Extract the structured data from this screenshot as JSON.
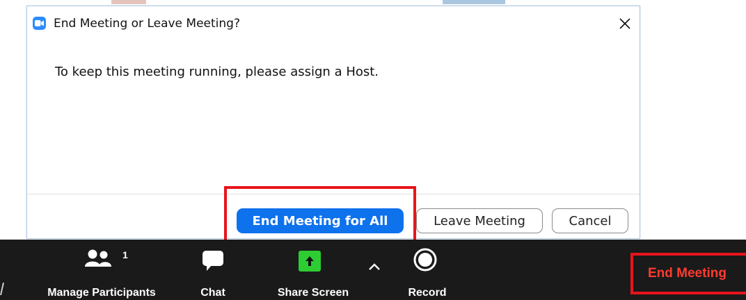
{
  "dialog": {
    "title": "End Meeting or Leave Meeting?",
    "message": "To keep this meeting running, please assign a Host.",
    "buttons": {
      "end_for_all": "End Meeting for All",
      "leave": "Leave Meeting",
      "cancel": "Cancel"
    },
    "icons": {
      "app": "zoom-camera-icon",
      "close": "close-icon"
    }
  },
  "toolbar": {
    "manage_participants": {
      "label": "Manage Participants",
      "count": "1",
      "icon": "participants-icon"
    },
    "chat": {
      "label": "Chat",
      "icon": "chat-icon"
    },
    "share_screen": {
      "label": "Share Screen",
      "icon": "share-screen-icon"
    },
    "record": {
      "label": "Record",
      "icon": "record-icon"
    },
    "end_meeting": {
      "label": "End Meeting"
    }
  },
  "colors": {
    "primary_blue": "#0e72ed",
    "highlight_red": "#e8141c",
    "end_meeting_red": "#ff3b30",
    "share_green": "#2dcc33",
    "toolbar_bg": "#1a1a1a"
  }
}
